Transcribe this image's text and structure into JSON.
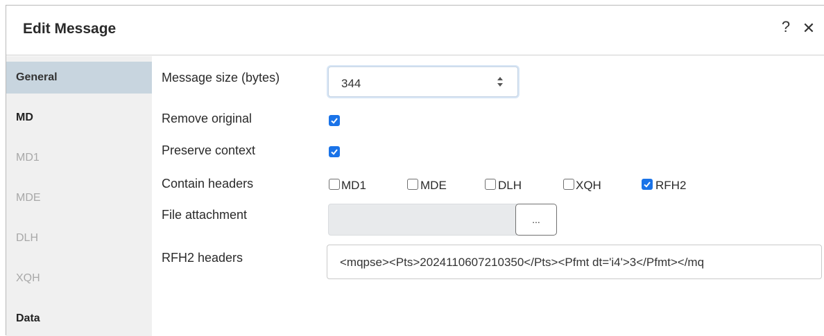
{
  "dialog": {
    "title": "Edit Message",
    "help_label": "?",
    "close_label": "✕"
  },
  "sidebar": {
    "items": [
      {
        "label": "General",
        "state": "active"
      },
      {
        "label": "MD",
        "state": "bold"
      },
      {
        "label": "MD1",
        "state": "muted"
      },
      {
        "label": "MDE",
        "state": "muted"
      },
      {
        "label": "DLH",
        "state": "muted"
      },
      {
        "label": "XQH",
        "state": "muted"
      },
      {
        "label": "Data",
        "state": "bold"
      }
    ]
  },
  "form": {
    "message_size": {
      "label": "Message size (bytes)",
      "value": "344"
    },
    "remove_original": {
      "label": "Remove original",
      "checked": true
    },
    "preserve_context": {
      "label": "Preserve context",
      "checked": true
    },
    "contain_headers": {
      "label": "Contain headers",
      "options": [
        {
          "label": "MD1",
          "checked": false
        },
        {
          "label": "MDE",
          "checked": false
        },
        {
          "label": "DLH",
          "checked": false
        },
        {
          "label": "XQH",
          "checked": false
        },
        {
          "label": "RFH2",
          "checked": true
        }
      ]
    },
    "file_attachment": {
      "label": "File attachment",
      "value": "",
      "browse_label": "..."
    },
    "rfh2_headers": {
      "label": "RFH2 headers",
      "value": "<mqpse><Pts>2024110607210350</Pts><Pfmt dt='i4'>3</Pfmt></mq"
    }
  },
  "colors": {
    "accent": "#1a73e8",
    "sidebar_bg": "#f0f0f0",
    "sidebar_active": "#c8d5df"
  }
}
